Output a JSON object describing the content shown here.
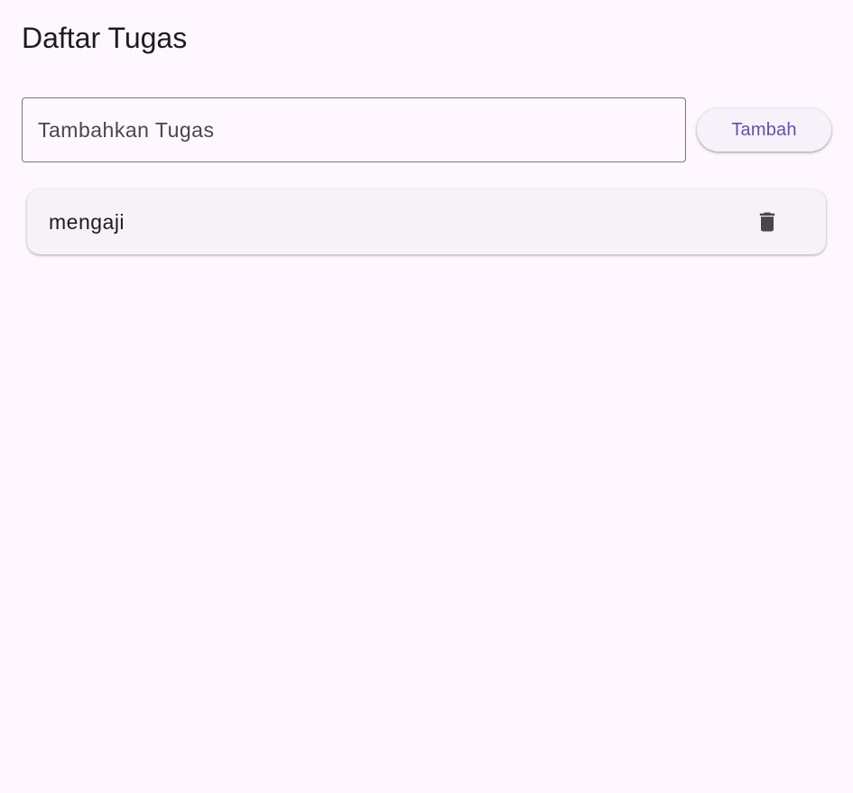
{
  "app_bar": {
    "title": "Daftar Tugas"
  },
  "task_form": {
    "input_placeholder": "Tambahkan Tugas",
    "input_value": "",
    "add_button_label": "Tambah"
  },
  "tasks": [
    {
      "label": "mengaji",
      "action_icon": "delete-icon"
    }
  ],
  "colors": {
    "background": "#fef7ff",
    "accent": "#6750a4",
    "card_background": "#f5f3f7",
    "icon": "#49454f",
    "outline": "#79747e"
  }
}
